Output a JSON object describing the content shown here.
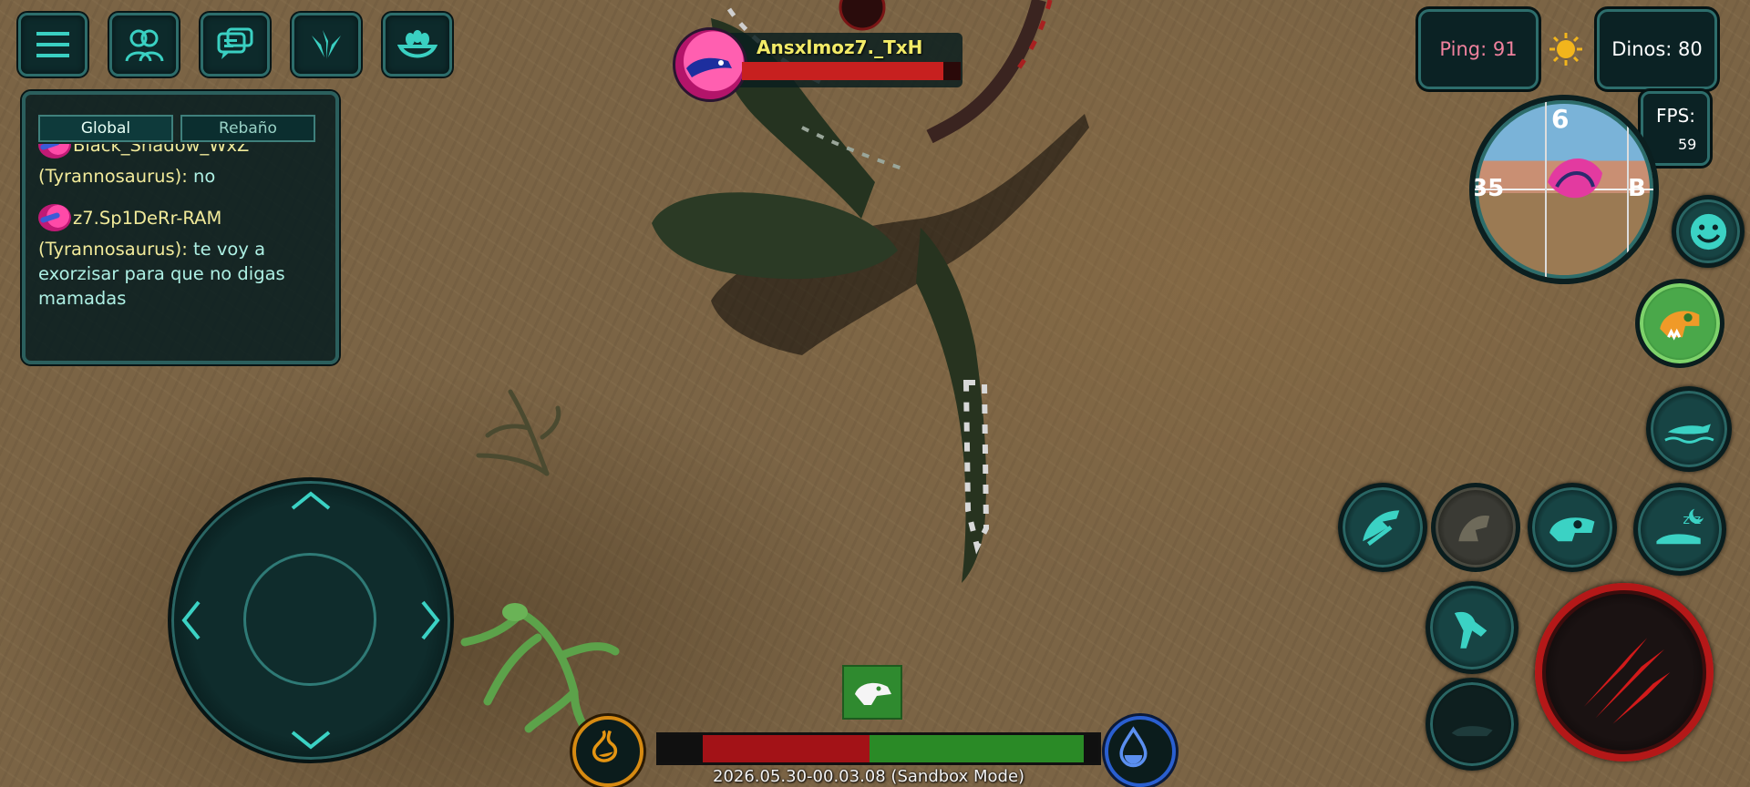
{
  "top_bar": {
    "buttons": [
      {
        "name": "menu-button",
        "icon": "hamburger-icon"
      },
      {
        "name": "friends-button",
        "icon": "friends-icon"
      },
      {
        "name": "chat-button",
        "icon": "chat-icon"
      },
      {
        "name": "skills-button",
        "icon": "claw-icon"
      },
      {
        "name": "nest-button",
        "icon": "nest-icon"
      }
    ]
  },
  "chat": {
    "tabs": [
      "Global",
      "Rebaño"
    ],
    "active_tab": "Global",
    "messages": [
      {
        "player": "Black_Shadow_WxZ",
        "species": "(Tyrannosaurus):",
        "text": "no"
      },
      {
        "player": "z7.Sp1DeRr-RAM",
        "species": "(Tyrannosaurus):",
        "text": "te voy a exorzisar para que no digas mamadas"
      }
    ]
  },
  "player_tag": {
    "name": "Ansxlmoz7._TxH",
    "health_fraction": 0.92,
    "avatar_color": "#e5409c"
  },
  "status": {
    "ping_label": "Ping: 91",
    "dinos_label": "Dinos: 80",
    "fps_label": "FPS:",
    "fps_value": "59",
    "weather_icon": "sun-icon"
  },
  "compass": {
    "heading_marks": [
      "6",
      "35",
      "B"
    ]
  },
  "right_controls": [
    {
      "name": "emote-button",
      "icon": "smiley-icon"
    },
    {
      "name": "dino-select-button",
      "icon": "t-rex-skull-icon"
    },
    {
      "name": "swim-button",
      "icon": "swimming-dino-icon"
    },
    {
      "name": "bite-button",
      "icon": "bite-icon"
    },
    {
      "name": "call-button",
      "icon": "roar-icon"
    },
    {
      "name": "skull-button",
      "icon": "skull-icon"
    },
    {
      "name": "sleep-button",
      "icon": "sleep-icon"
    },
    {
      "name": "sprint-button",
      "icon": "running-dino-icon"
    },
    {
      "name": "crouch-button",
      "icon": "crouch-icon"
    },
    {
      "name": "attack-button",
      "icon": "claw-scratch-icon"
    }
  ],
  "vitals": {
    "hunger_icon": "stomach-icon",
    "thirst_icon": "water-drop-icon",
    "food_fraction": 0.38,
    "water_fraction": 0.58,
    "food_color": "#a31217",
    "water_color": "#2a8a26"
  },
  "selected_species_icon": "velociraptor-head-icon",
  "footer_text": "2026.05.30-00.03.08 (Sandbox Mode)"
}
